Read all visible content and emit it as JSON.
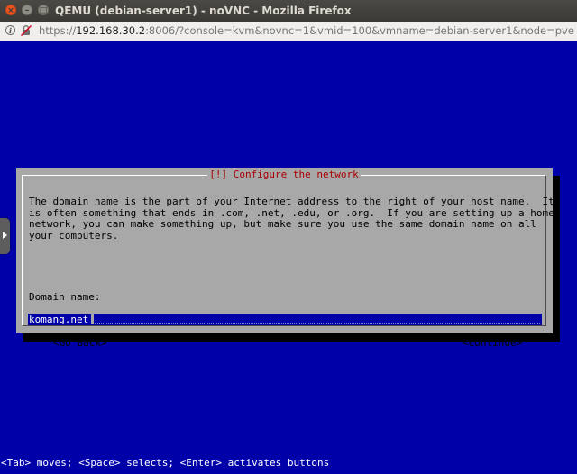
{
  "window": {
    "title": "QEMU (debian-server1) - noVNC - Mozilla Firefox",
    "close_glyph": "×",
    "min_glyph": "–",
    "max_glyph": "□"
  },
  "urlbar": {
    "scheme": "https://",
    "host": "192.168.30.2",
    "rest": ":8006/?console=kvm&novnc=1&vmid=100&vmname=debian-server1&node=pve",
    "info_glyph": "i"
  },
  "installer": {
    "dialog_title": "[!] Configure the network",
    "description": "The domain name is the part of your Internet address to the right of your host name.  It\nis often something that ends in .com, .net, .edu, or .org.  If you are setting up a home\nnetwork, you can make something up, but make sure you use the same domain name on all\nyour computers.",
    "field_label": "Domain name:",
    "field_value": "komang.net",
    "back_button": "<Go Back>",
    "continue_button": "<Continue>",
    "help_line": "<Tab> moves; <Space> selects; <Enter> activates buttons"
  },
  "colors": {
    "console_background": "#0000a8",
    "dialog_background": "#a8a8a8",
    "dialog_title": "#a80000",
    "input_background": "#0000a8",
    "ubuntu_close": "#e95420"
  }
}
